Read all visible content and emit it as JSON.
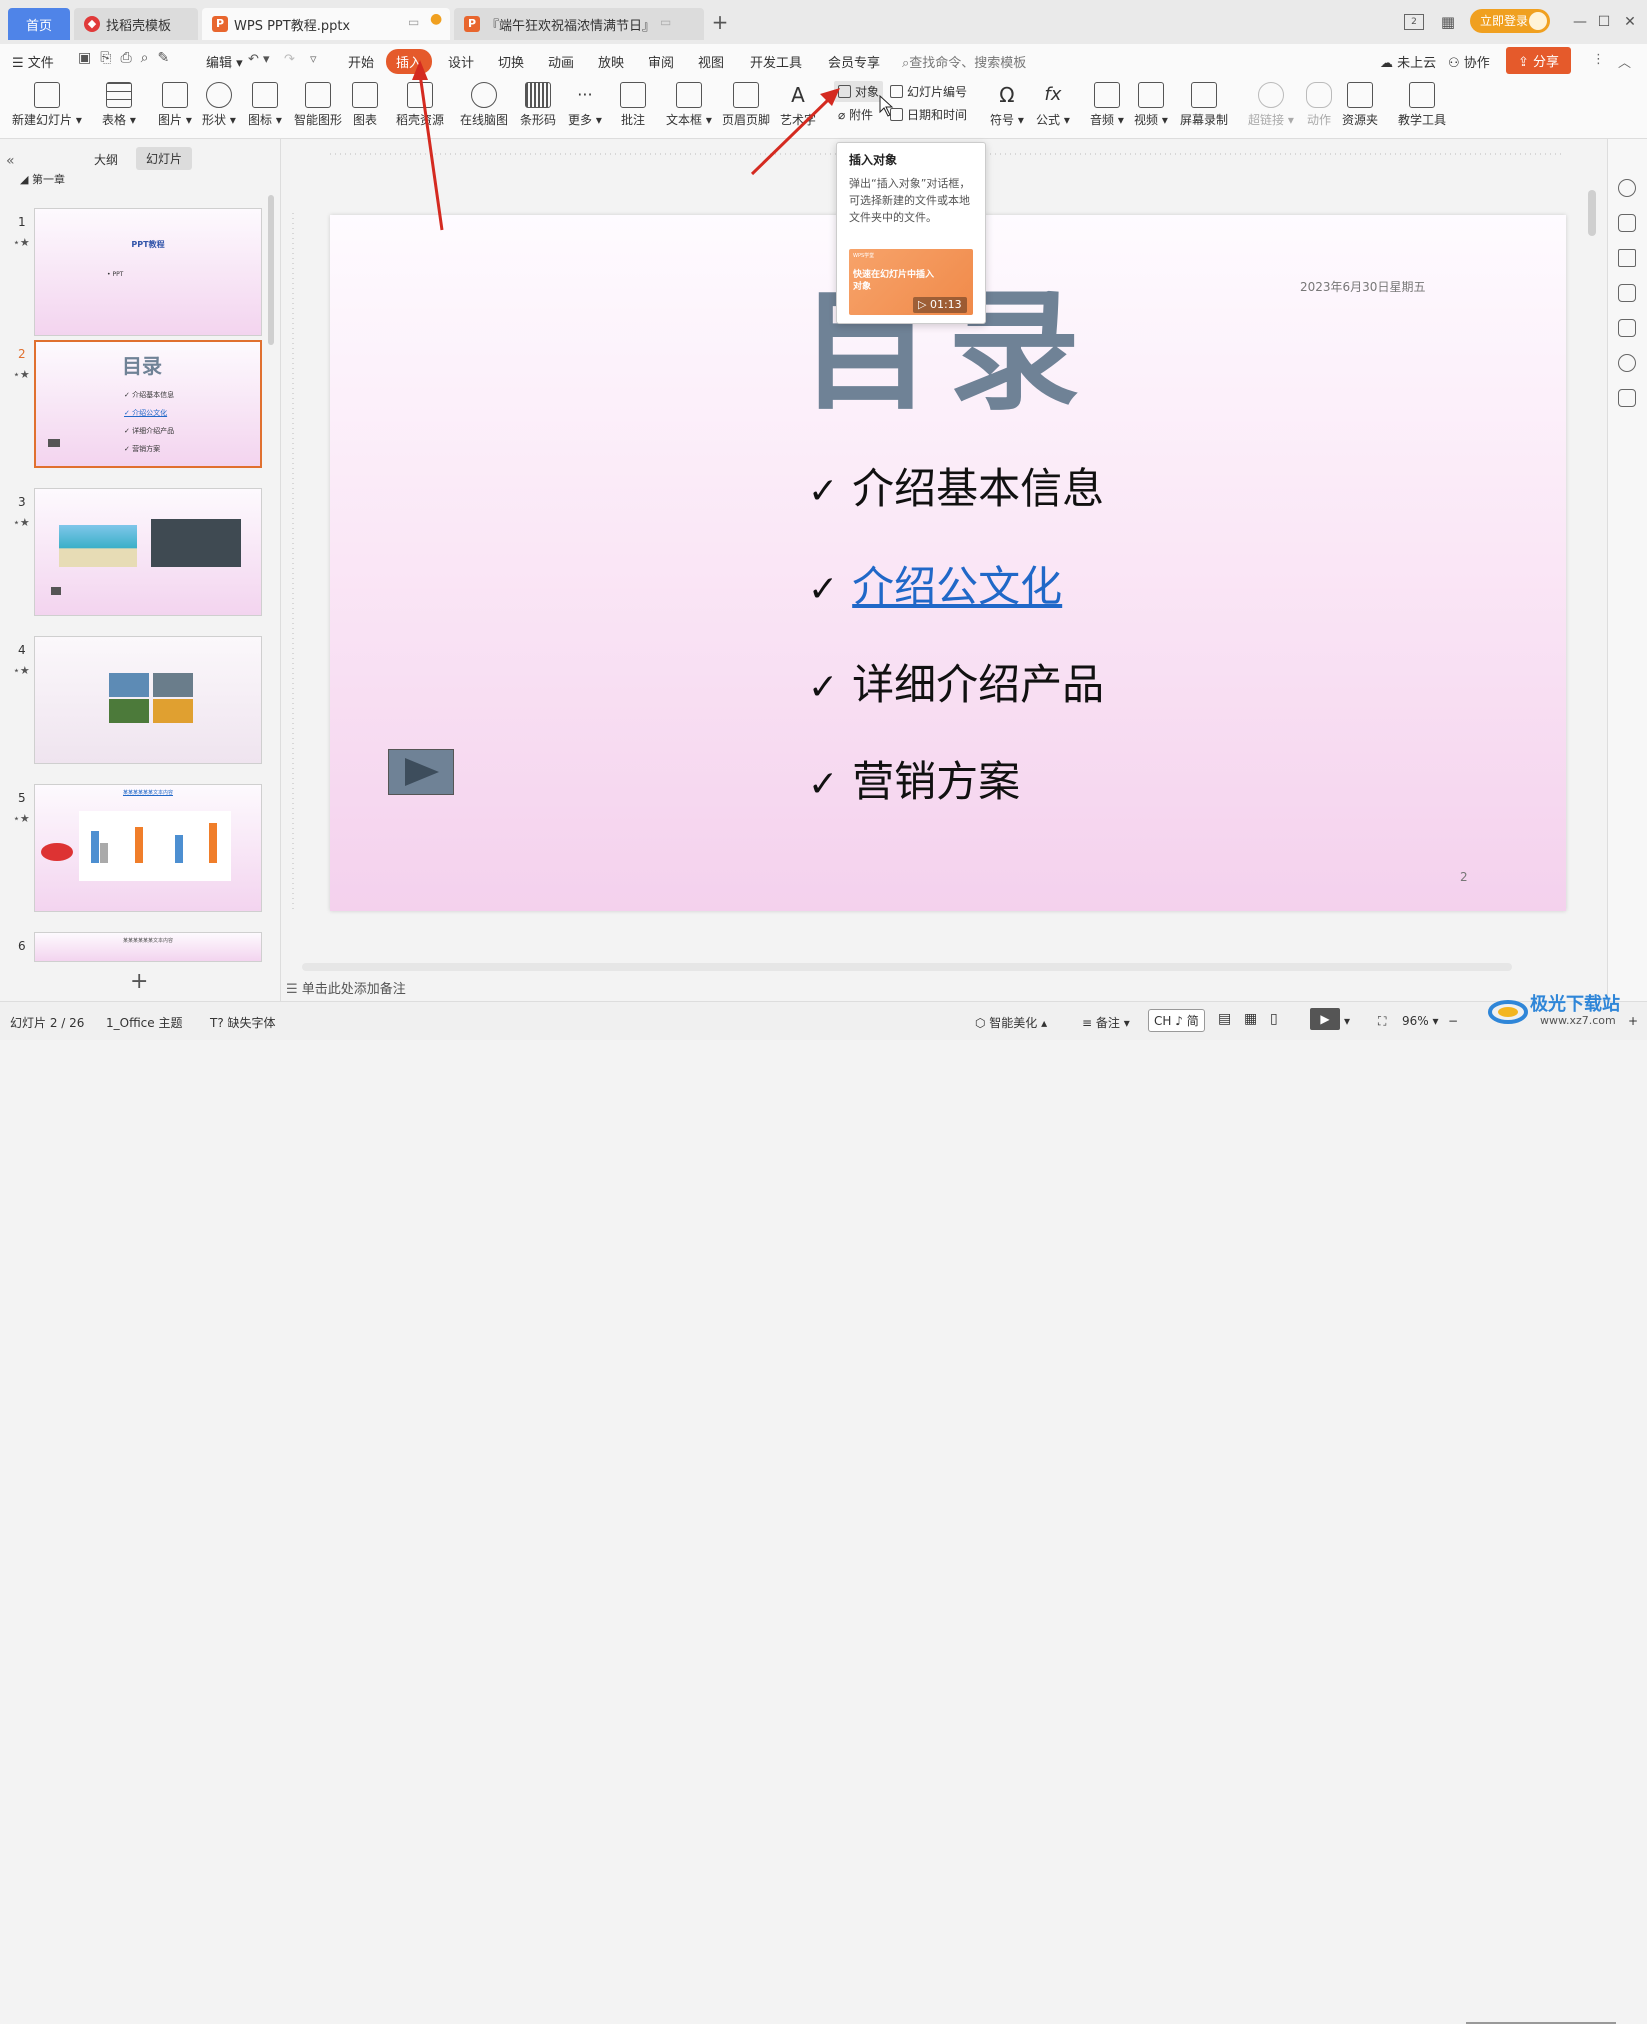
{
  "tabs": [
    {
      "label": "首页",
      "active": false,
      "home": true
    },
    {
      "label": "找稻壳模板"
    },
    {
      "label": "WPS PPT教程.pptx",
      "active": true
    },
    {
      "label": "『端午狂欢祝福浓情满节日』"
    }
  ],
  "titlebar": {
    "login_label": "立即登录"
  },
  "menu": {
    "file": "文件",
    "edit": "编辑",
    "items": [
      "开始",
      "插入",
      "设计",
      "切换",
      "动画",
      "放映",
      "审阅",
      "视图",
      "开发工具",
      "会员专享"
    ],
    "active": "插入",
    "search_placeholder": "查找命令、搜索模板",
    "cloud": "未上云",
    "collab": "协作",
    "share": "分享"
  },
  "ribbon": {
    "new_slide": "新建幻灯片",
    "table": "表格",
    "picture": "图片",
    "shape": "形状",
    "icon": "图标",
    "smart": "智能图形",
    "chart": "图表",
    "docer": "稻壳资源",
    "mindmap": "在线脑图",
    "barcode": "条形码",
    "more": "更多",
    "comment": "批注",
    "textbox": "文本框",
    "header_footer": "页眉页脚",
    "wordart": "艺术字",
    "object": "对象",
    "attachment": "附件",
    "slide_number": "幻灯片编号",
    "datetime": "日期和时间",
    "symbol": "符号",
    "formula": "公式",
    "audio": "音频",
    "video": "视频",
    "screen_record": "屏幕录制",
    "hyperlink": "超链接",
    "action": "动作",
    "resource": "资源夹",
    "teaching": "教学工具"
  },
  "tooltip": {
    "title": "插入对象",
    "body": "弹出“插入对象”对话框，可选择新建的文件或本地文件夹中的文件。",
    "video_tag": "WPS学堂",
    "video_caption": "快速在幻灯片中插入对象",
    "video_time": "01:13"
  },
  "panel": {
    "outline_tab": "大纲",
    "slides_tab": "幻灯片",
    "section": "第一章",
    "thumbs": [
      {
        "num": "1",
        "title": "PPT教程",
        "sub": "• PPT"
      },
      {
        "num": "2",
        "title": "目录",
        "items": [
          "✓ 介绍基本信息",
          "✓ 介绍公文化",
          "✓ 详细介绍产品",
          "✓ 营销方案"
        ]
      },
      {
        "num": "3"
      },
      {
        "num": "4"
      },
      {
        "num": "5",
        "title": "某某某某某某文本内容"
      },
      {
        "num": "6",
        "title": "某某某某某某文本内容"
      }
    ]
  },
  "slide": {
    "title": "目录",
    "date": "2023年6月30日星期五",
    "items": [
      {
        "text": "介绍基本信息",
        "link": false
      },
      {
        "text": "介绍公文化",
        "link": true
      },
      {
        "text": "详细介绍产品",
        "link": false
      },
      {
        "text": "营销方案",
        "link": false
      }
    ],
    "page_number": "2",
    "check_symbol": "✓"
  },
  "notes_placeholder": "单击此处添加备注",
  "status": {
    "slide_info": "幻灯片 2 / 26",
    "theme": "1_Office 主题",
    "missing_font": "缺失字体",
    "beautify": "智能美化",
    "notes": "备注",
    "ime": "CH ♪ 简",
    "zoom": "96%"
  },
  "watermark": {
    "text": "极光下载站",
    "url": "www.xz7.com"
  },
  "colors": {
    "accent": "#e55a2b",
    "link": "#2068c8",
    "title_gray": "#6f8296"
  }
}
